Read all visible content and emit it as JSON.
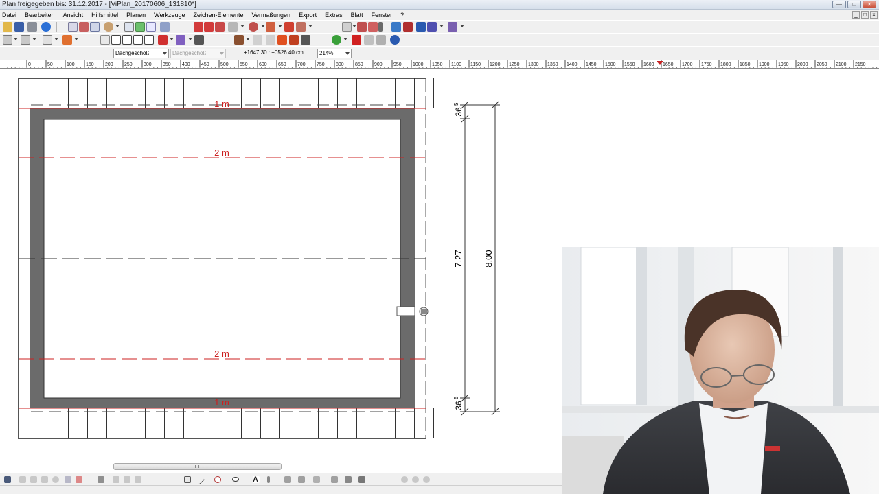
{
  "window": {
    "title": "Plan freigegeben bis: 31.12.2017 - [ViPlan_20170606_131810*]"
  },
  "menu": {
    "items": [
      "Datei",
      "Bearbeiten",
      "Ansicht",
      "Hilfsmittel",
      "Planen",
      "Werkzeuge",
      "Zeichen-Elemente",
      "Vermaßungen",
      "Export",
      "Extras",
      "Blatt",
      "Fenster",
      "?"
    ]
  },
  "toolbar3": {
    "floor_select": "Dachgeschoß",
    "ref_floor_select": "Dachgeschoß",
    "coordinates": "+1647.30 : +0526.40 cm",
    "zoom": "214%"
  },
  "ruler": {
    "labels": [
      "0",
      "50",
      "100",
      "150",
      "200",
      "250",
      "300",
      "350",
      "400",
      "450",
      "500",
      "550",
      "600",
      "650",
      "700",
      "750",
      "800",
      "850",
      "900",
      "950",
      "1000",
      "1050",
      "1100",
      "1150",
      "1200",
      "1250",
      "1300",
      "1350",
      "1400",
      "1450",
      "1500",
      "1550",
      "1600",
      "1650",
      "1700",
      "1750",
      "1800",
      "1850",
      "1900",
      "1950",
      "2000",
      "2050",
      "2100",
      "2150"
    ]
  },
  "drawing": {
    "line_labels": {
      "top_1m": "1 m",
      "top_2m": "2 m",
      "bottom_2m": "2 m",
      "bottom_1m": "1 m"
    },
    "dimensions": {
      "top_wall": "36",
      "top_wall_sup": "5",
      "inner": "7.27",
      "bottom_wall": "36",
      "bottom_wall_sup": "5",
      "overall": "8.00"
    }
  },
  "colors": {
    "wall": "#6b6b6b",
    "height_line": "#cc2020",
    "toolbar_bg": "#f0f0f0"
  }
}
